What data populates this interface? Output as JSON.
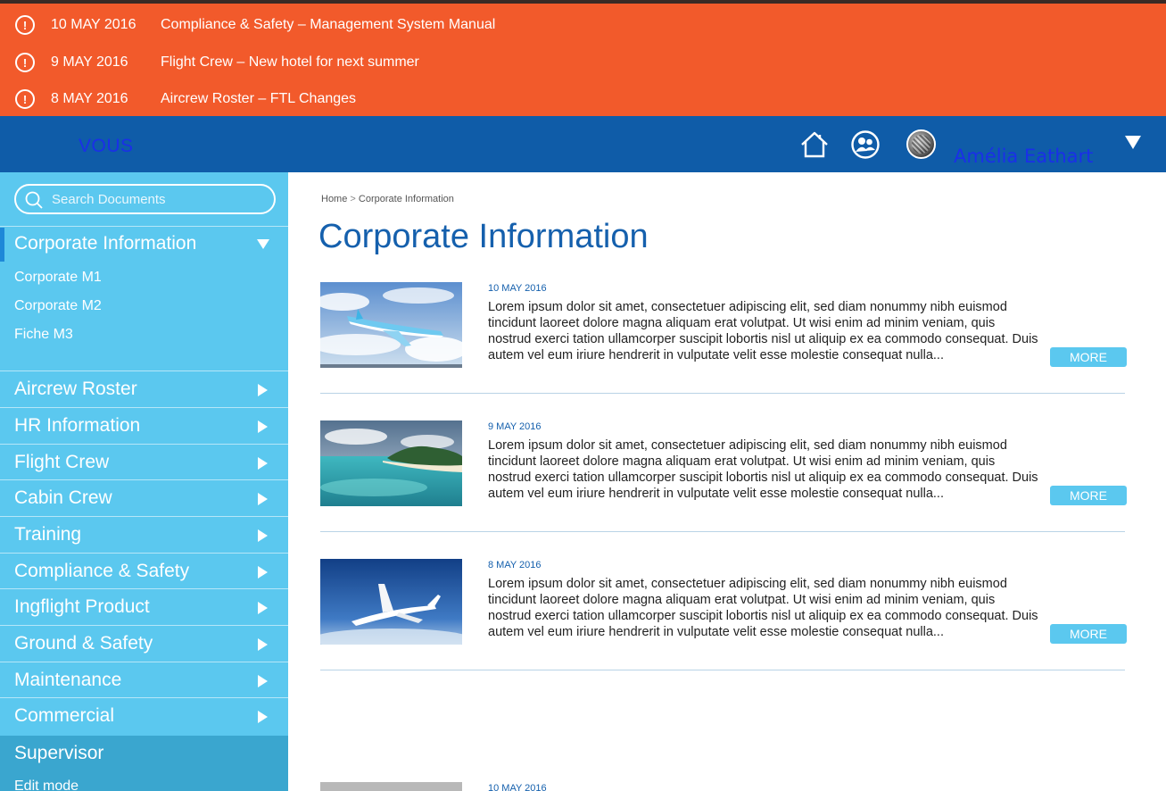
{
  "alerts": [
    {
      "date": "10 MAY 2016",
      "text": "Compliance & Safety – Management System Manual"
    },
    {
      "date": "9 MAY 2016",
      "text": "Flight Crew – New hotel for next summer"
    },
    {
      "date": "8 MAY 2016",
      "text": "Aircrew Roster – FTL Changes"
    }
  ],
  "alert_icon_glyph": "!",
  "header": {
    "brand": "VOUS",
    "user_name": "Amélia Eathart"
  },
  "sidebar": {
    "search_placeholder": "Search Documents",
    "section": {
      "title": "Corporate Information",
      "items": [
        "Corporate M1",
        "Corporate M2",
        "Fiche M3"
      ]
    },
    "nav": [
      "Aircrew Roster",
      "HR Information",
      "Flight Crew",
      "Cabin Crew",
      "Training",
      "Compliance & Safety",
      "Ingflight Product",
      "Ground & Safety",
      "Maintenance",
      "Commercial"
    ],
    "supervisor": {
      "title": "Supervisor",
      "sub": "Edit mode"
    }
  },
  "main": {
    "breadcrumb": {
      "home": "Home",
      "separator": ">",
      "current": "Corporate Information"
    },
    "title": "Corporate Information",
    "more_label": "MORE",
    "articles": [
      {
        "date": "10 MAY 2016",
        "text": "Lorem ipsum dolor sit amet, consectetuer adipiscing elit, sed diam nonummy nibh euismod tincidunt laoreet dolore magna aliquam erat volutpat. Ut wisi enim ad minim veniam, quis nostrud exerci tation ullamcorper suscipit lobortis nisl ut aliquip ex ea commodo consequat. Duis autem vel eum iriure hendrerit in vulputate velit esse molestie consequat nulla...",
        "image": "airplane-sky"
      },
      {
        "date": "9 MAY 2016",
        "text": "Lorem ipsum dolor sit amet, consectetuer adipiscing elit, sed diam nonummy nibh euismod tincidunt laoreet dolore magna aliquam erat volutpat. Ut wisi enim ad minim veniam, quis nostrud exerci tation ullamcorper suscipit lobortis nisl ut aliquip ex ea commodo consequat. Duis autem vel eum iriure hendrerit in vulputate velit esse molestie consequat nulla...",
        "image": "tropical-beach"
      },
      {
        "date": "8 MAY 2016",
        "text": "Lorem ipsum dolor sit amet, consectetuer adipiscing elit, sed diam nonummy nibh euismod tincidunt laoreet dolore magna aliquam erat volutpat. Ut wisi enim ad minim veniam, quis nostrud exerci tation ullamcorper suscipit lobortis nisl ut aliquip ex ea commodo consequat. Duis autem vel eum iriure hendrerit in vulputate velit esse molestie consequat nulla...",
        "image": "white-airplane"
      },
      {
        "date": "10 MAY 2016",
        "text": "",
        "image": "grey-thumbnail"
      }
    ]
  },
  "colors": {
    "alert_bg": "#f25a2b",
    "header_bg": "#0f5ca8",
    "sidebar_bg": "#5bc8ef",
    "supervisor_bg": "#3aa6cf",
    "title_blue": "#1560ad",
    "brand_text": "#1a2fe8"
  }
}
